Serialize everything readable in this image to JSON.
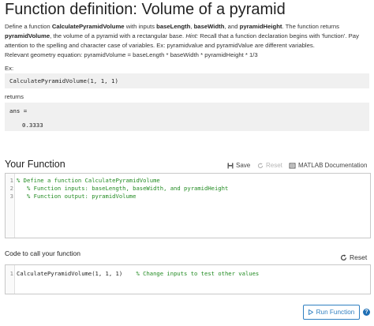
{
  "problem": {
    "title": "Function definition: Volume of a pyramid",
    "desc": {
      "t1": "Define a function ",
      "fn_name": "CalculatePyramidVolume",
      "t2": " with inputs ",
      "in1": "baseLength",
      "t3": ", ",
      "in2": "baseWidth",
      "t4": ", and ",
      "in3": "pyramidHeight",
      "t5": ". The function returns ",
      "out": "pyramidVolume",
      "t6": ", the volume of a pyramid with a rectangular base. ",
      "hint": "Hint:",
      "t7": " Recall that a function declaration begins with 'function'. Pay attention to the spelling and character case of variables. Ex: pyramidvalue and pyramidValue are different variables."
    },
    "equation": "Relevant geometry equation: pyramidVolume = baseLength * baseWidth * pyramidHeight * 1/3",
    "ex_label": "Ex:",
    "ex_code": "CalculatePyramidVolume(1, 1, 1)",
    "returns_label": "returns",
    "ans_line": "ans =",
    "ans_value": "0.3333"
  },
  "your_function": {
    "title": "Your Function",
    "save_label": "Save",
    "reset_label": "Reset",
    "doc_label": "MATLAB Documentation",
    "lines": [
      {
        "num": "1",
        "text": "% Define a function CalculatePyramidVolume"
      },
      {
        "num": "2",
        "text": "   % Function inputs: baseLength, baseWidth, and pyramidHeight"
      },
      {
        "num": "3",
        "text": "   % Function output: pyramidVolume"
      }
    ]
  },
  "call_section": {
    "title": "Code to call your function",
    "reset_label": "Reset",
    "line_num": "1",
    "call_code": "CalculatePyramidVolume(1, 1, 1)",
    "call_comment": "% Change inputs to test other values"
  },
  "run_label": "Run Function",
  "help_label": "?",
  "colors": {
    "accent": "#2f7fc1",
    "comment_green": "#228B22",
    "code_bg": "#f0f0f0"
  }
}
